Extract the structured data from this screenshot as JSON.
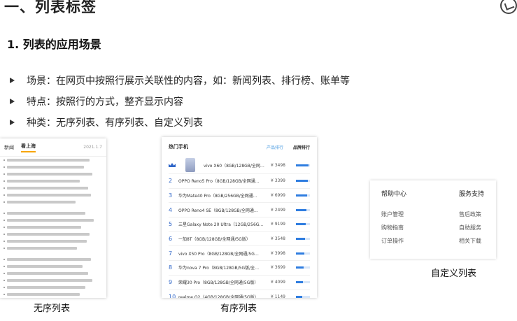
{
  "slide": {
    "title": "一、列表标签",
    "subtitle": "1. 列表的应用场景",
    "bullets": [
      "场景：在网页中按照行展示关联性的内容，如：新闻列表、排行榜、账单等",
      "特点：按照行的方式，整齐显示内容",
      "种类：无序列表、有序列表、自定义列表"
    ]
  },
  "news": {
    "tabs": [
      "新闻",
      "看上海"
    ],
    "date": "2021.1.7"
  },
  "rank": {
    "title": "热门手机",
    "tab_product": "产品排行",
    "tab_brand": "品牌排行",
    "top": {
      "name": "vivo X60（8GB/128GB/全网…",
      "price": "¥ 3498",
      "level": 0.9
    },
    "items": [
      {
        "num": "2",
        "name": "OPPO Reno5 Pro（8GB/128GB/全网通…",
        "price": "¥ 3399",
        "level": 0.85
      },
      {
        "num": "3",
        "name": "华为Mate40 Pro（8GB/256GB/全网通…",
        "price": "¥ 6999",
        "level": 0.8
      },
      {
        "num": "4",
        "name": "OPPO Reno4 SE（8GB/128GB/全网通…",
        "price": "¥ 2499",
        "level": 0.75
      },
      {
        "num": "5",
        "name": "三星Galaxy Note 20 Ultra（12GB/256G…",
        "price": "¥ 9199",
        "level": 0.7
      },
      {
        "num": "6",
        "name": "一加8T（8GB/128GB/全网通/5G版）",
        "price": "¥ 3548",
        "level": 0.65
      },
      {
        "num": "7",
        "name": "vivo X50 Pro（8GB/128GB/全网通/5G…",
        "price": "¥ 3998",
        "level": 0.6
      },
      {
        "num": "8",
        "name": "华为nova 7 Pro（8GB/128GB/5G版/全…",
        "price": "¥ 3699",
        "level": 0.55
      },
      {
        "num": "9",
        "name": "荣耀30 Pro（8GB/128GB/全网通/5G版）",
        "price": "¥ 4099",
        "level": 0.5
      },
      {
        "num": "10",
        "name": "realme Q2（4GB/128GB/全网通/5G版）",
        "price": "¥ 1149",
        "level": 0.45
      }
    ]
  },
  "help": {
    "col1_head": "帮助中心",
    "col1_items": [
      "账户管理",
      "购物指南",
      "订单操作"
    ],
    "col2_head": "服务支持",
    "col2_items": [
      "售后政策",
      "自助服务",
      "相关下载"
    ]
  },
  "captions": {
    "unordered": "无序列表",
    "ordered": "有序列表",
    "custom": "自定义列表"
  }
}
